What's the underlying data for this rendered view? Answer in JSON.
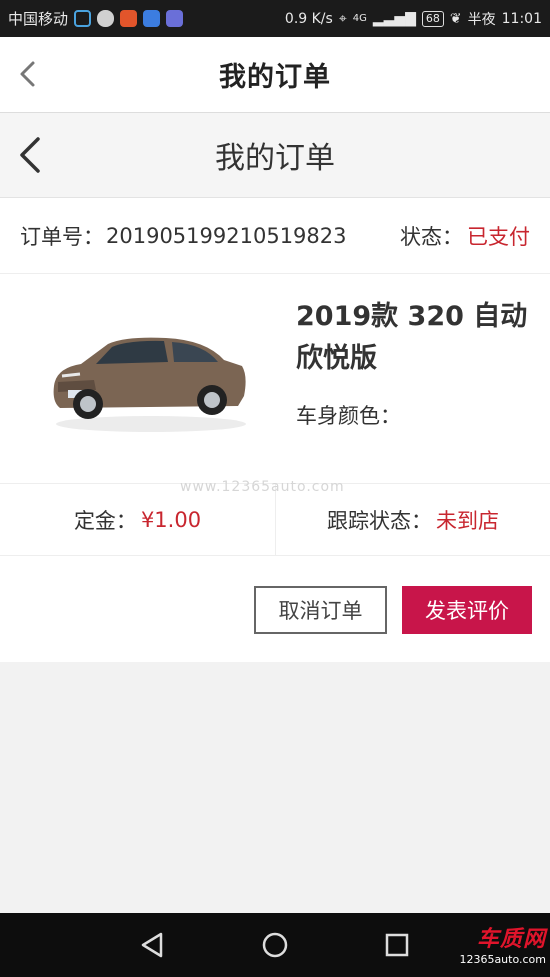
{
  "status_bar": {
    "carrier": "中国移动",
    "speed": "0.9 K/s",
    "network": "4G",
    "battery": "68",
    "period": "半夜",
    "time": "11:01"
  },
  "app_header": {
    "title": "我的订单"
  },
  "web_header": {
    "title": "我的订单"
  },
  "order": {
    "number_label": "订单号：",
    "number": "201905199210519823",
    "status_label": "状态：",
    "status": "已支付"
  },
  "product": {
    "name": "2019款 320 自动欣悦版",
    "color_label": "车身颜色："
  },
  "meta": {
    "deposit_label": "定金：",
    "deposit": "¥1.00",
    "tracking_label": "跟踪状态：",
    "tracking": "未到店"
  },
  "actions": {
    "cancel": "取消订单",
    "review": "发表评价"
  },
  "watermark": "www.12365auto.com",
  "logo": {
    "title": "车质网",
    "url": "12365auto.com"
  },
  "colors": {
    "accent": "#c8154a",
    "status_red": "#c8262f"
  }
}
